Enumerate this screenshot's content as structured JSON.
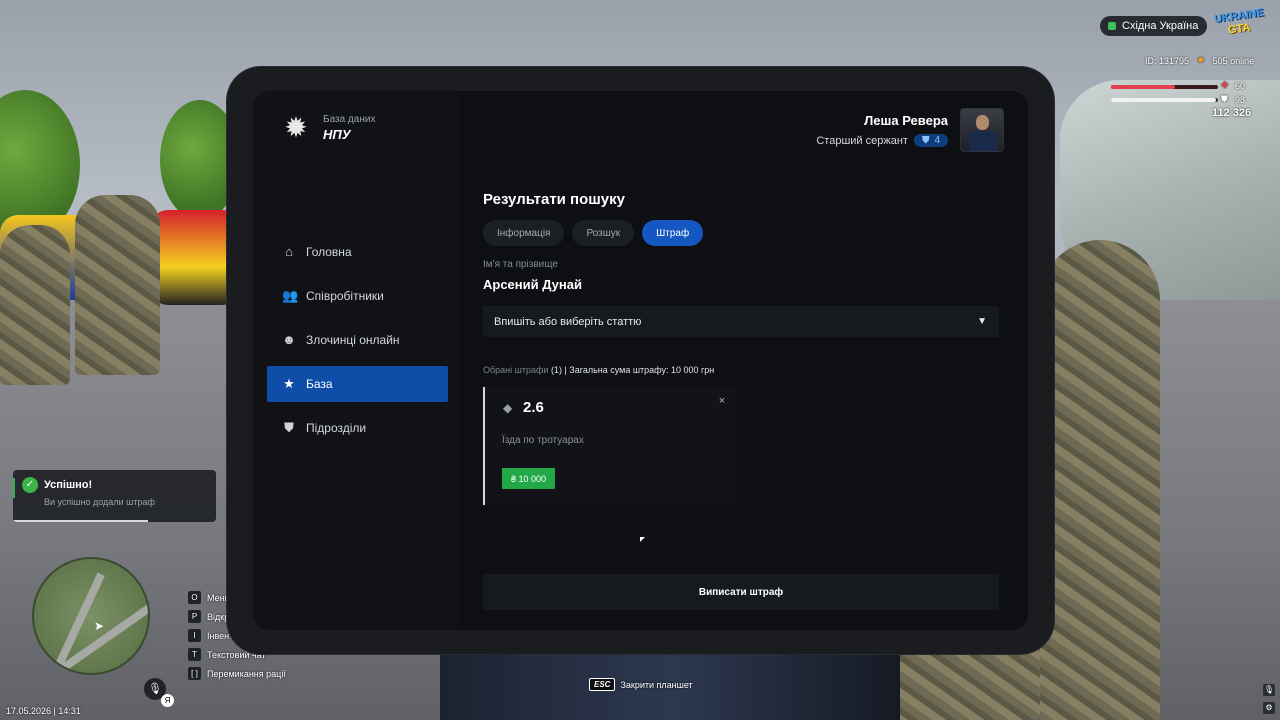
{
  "hud": {
    "region": "Східна Україна",
    "logo_line1": "UKRAINE",
    "logo_line2": "GTA",
    "player_id": "ID: 131795",
    "online": "505 online",
    "health": "60",
    "health_level": 0.6,
    "armor": "98",
    "armor_level": 0.98,
    "money": "112 326",
    "datetime": "17.05.2026 | 14:31",
    "voice_key": "Я",
    "esc_key": "ESC",
    "esc_label": "Закрити планшет",
    "hotkeys": [
      {
        "key": "O",
        "label": "Меню"
      },
      {
        "key": "P",
        "label": "Відкрити"
      },
      {
        "key": "I",
        "label": "Інвентар"
      },
      {
        "key": "T",
        "label": "Текстовий чат"
      },
      {
        "key": "[ ]",
        "label": "Перемикання рації"
      }
    ]
  },
  "toast": {
    "title": "Успішно!",
    "message": "Ви успішно додали штраф"
  },
  "tablet": {
    "brand": {
      "subtitle": "База даних",
      "name": "НПУ"
    },
    "user": {
      "name": "Леша Ревера",
      "rank": "Старший сержант",
      "rank_level": "4"
    },
    "nav": [
      {
        "label": "Головна",
        "icon": "home-icon"
      },
      {
        "label": "Співробітники",
        "icon": "users-icon"
      },
      {
        "label": "Злочинці онлайн",
        "icon": "mask-icon"
      },
      {
        "label": "База",
        "icon": "star-icon",
        "active": true
      },
      {
        "label": "Підрозділи",
        "icon": "shield-icon"
      }
    ],
    "results": {
      "title": "Результати пошуку",
      "tabs": [
        "Інформація",
        "Розшук",
        "Штраф"
      ],
      "active_tab": "Штраф",
      "name_label": "Ім'я та прізвище",
      "person_name": "Арсений Дунай",
      "article_placeholder": "Впишіть або виберіть статтю",
      "summary_prefix": "Обрані штрафи",
      "summary_count": "(1)",
      "summary_total": "| Загальна сума штрафу: 10 000 грн",
      "fine": {
        "code": "2.6",
        "description": "Їзда по тротуарах",
        "amount": "₴ 10 000"
      },
      "submit_label": "Виписати штраф"
    }
  },
  "colors": {
    "accent": "#1557c0",
    "nav_active": "#0e4ea8",
    "success": "#23a847",
    "health": "#e0414b"
  }
}
